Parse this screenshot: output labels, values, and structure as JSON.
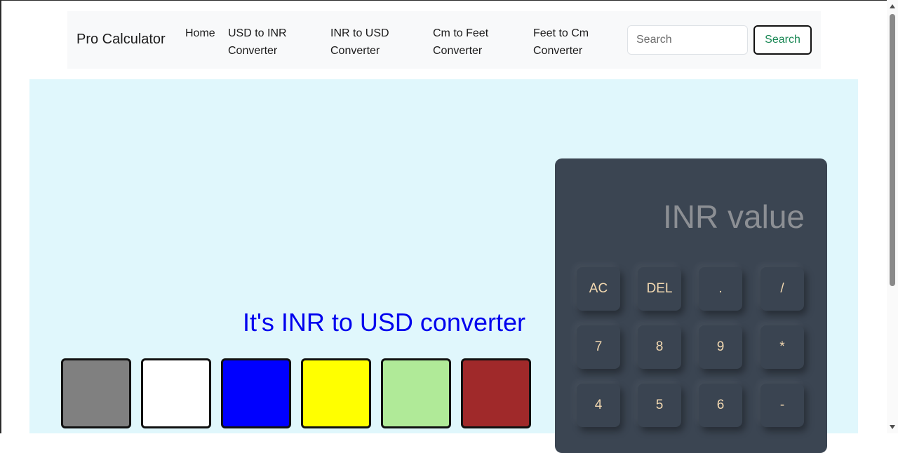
{
  "navbar": {
    "brand": "Pro Calculator",
    "links": [
      {
        "line1": "Home",
        "line2": ""
      },
      {
        "line1": "USD to INR",
        "line2": "Converter"
      },
      {
        "line1": "INR to USD",
        "line2": "Converter"
      },
      {
        "line1": "Cm to Feet",
        "line2": "Converter"
      },
      {
        "line1": "Feet to Cm",
        "line2": "Converter"
      }
    ],
    "search_placeholder": "Search",
    "search_button": "Search"
  },
  "main": {
    "heading": "It's INR to USD converter",
    "swatches": [
      {
        "color": "#808080"
      },
      {
        "color": "#ffffff"
      },
      {
        "color": "#0000ff"
      },
      {
        "color": "#ffff00"
      },
      {
        "color": "#b0ea98"
      },
      {
        "color": "#a0292a"
      }
    ]
  },
  "calculator": {
    "display_placeholder": "INR value",
    "keys": [
      [
        "AC",
        "DEL",
        ".",
        "/"
      ],
      [
        "7",
        "8",
        "9",
        "*"
      ],
      [
        "4",
        "5",
        "6",
        "-"
      ]
    ]
  },
  "colors": {
    "accent_text": "#0000ee",
    "search_button_text": "#198754",
    "calculator_bg": "#3b4552",
    "key_text": "#f3d9b1"
  }
}
